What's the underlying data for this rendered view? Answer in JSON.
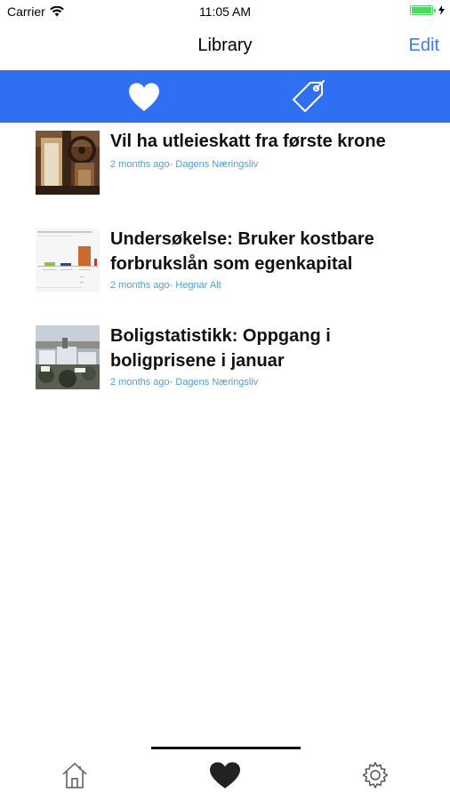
{
  "status_bar": {
    "carrier": "Carrier",
    "time": "11:05 AM",
    "battery_color": "#4cd964"
  },
  "nav": {
    "title": "Library",
    "edit_label": "Edit"
  },
  "segments": {
    "accent": "#2f6ff2",
    "items": [
      {
        "icon": "heart-icon",
        "selected": true
      },
      {
        "icon": "tag-icon",
        "selected": false
      }
    ]
  },
  "articles": [
    {
      "title": "Vil ha utleieskatt fra første krone",
      "meta": "2 months ago- Dagens Næringsliv",
      "thumbnail": "interior-photo"
    },
    {
      "title": "Undersøkelse: Bruker kostbare forbrukslån som egenkapital",
      "meta": "2 months ago- Hegnar Alt",
      "thumbnail": "bar-chart-image"
    },
    {
      "title": "Boligstatistikk: Oppgang i boligprisene i januar",
      "meta": "2 months ago- Dagens Næringsliv",
      "thumbnail": "city-snow-photo"
    }
  ],
  "tab_bar": {
    "items": [
      {
        "icon": "home-icon"
      },
      {
        "icon": "heart-icon",
        "selected": true
      },
      {
        "icon": "gear-icon"
      }
    ]
  }
}
